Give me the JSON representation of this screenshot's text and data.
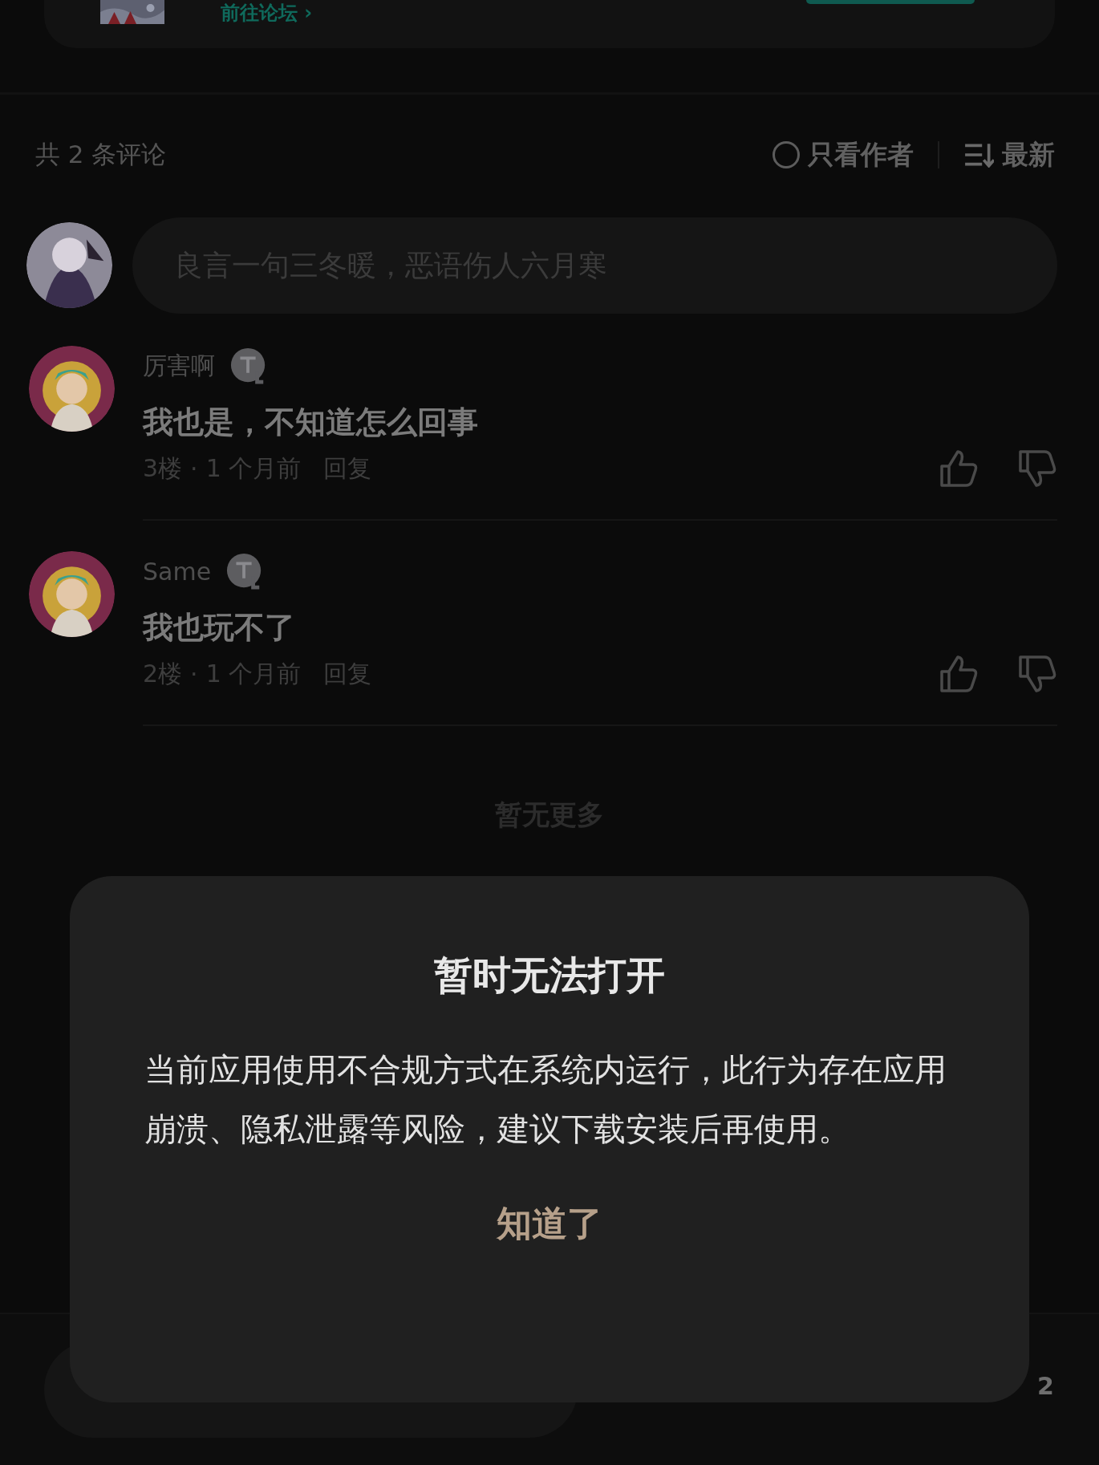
{
  "forum_card": {
    "link": "前往论坛 ›"
  },
  "comments_header": {
    "count": "共 2 条评论",
    "author_only": {
      "label": "只看作者",
      "checked": false
    },
    "sort": "最新"
  },
  "comment_input": {
    "placeholder": "良言一句三冬暖，恶语伤人六月寒"
  },
  "comments": [
    {
      "user": "厉害啊",
      "text": "我也是，不知道怎么回事",
      "floor": "3楼",
      "separator": "·",
      "time": "1 个月前",
      "reply": "回复"
    },
    {
      "user": "Same",
      "text": "我也玩不了",
      "floor": "2楼",
      "separator": "·",
      "time": "1 个月前",
      "reply": "回复"
    }
  ],
  "end_note": "暂无更多",
  "bottom_bar": {
    "comment_count": "2"
  },
  "dialog": {
    "title": "暂时无法打开",
    "message": "当前应用使用不合规方式在系统内运行，此行为存在应用崩溃、隐私泄露等风险，建议下载安装后再使用。",
    "button": "知道了"
  }
}
